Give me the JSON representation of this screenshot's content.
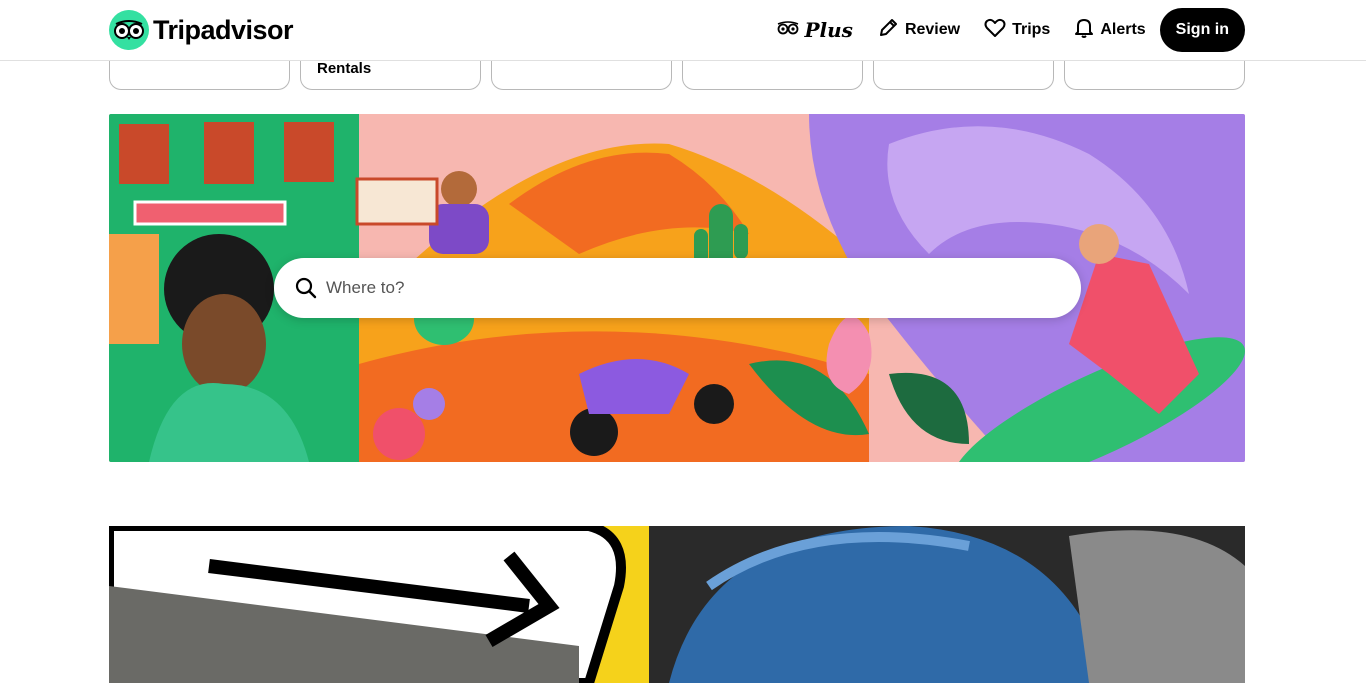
{
  "header": {
    "brand": "Tripadvisor",
    "plus_label": "Plus",
    "review_label": "Review",
    "trips_label": "Trips",
    "alerts_label": "Alerts",
    "signin_label": "Sign in"
  },
  "tiles": [
    {
      "label": ""
    },
    {
      "label": "Rentals"
    },
    {
      "label": ""
    },
    {
      "label": ""
    },
    {
      "label": ""
    },
    {
      "label": ""
    }
  ],
  "search": {
    "placeholder": "Where to?",
    "value": ""
  },
  "colors": {
    "brand_green": "#34e0a1",
    "hero_pink": "#f7b7b0",
    "hero_purple": "#a57ee6",
    "hero_orange": "#f26b21"
  }
}
